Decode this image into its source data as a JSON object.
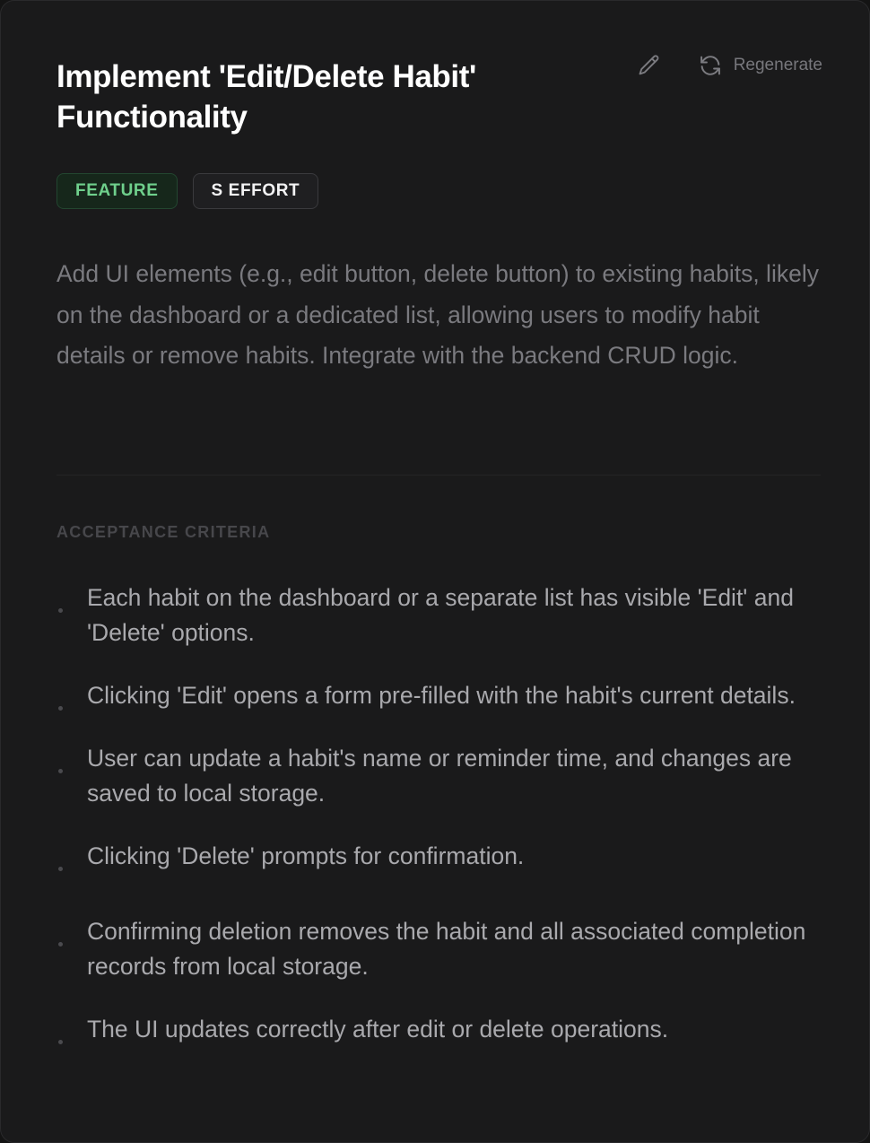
{
  "task": {
    "title": "Implement 'Edit/Delete Habit' Functionality",
    "edit_icon": "pencil-icon",
    "regenerate_icon": "refresh-icon",
    "regenerate_label": "Regenerate",
    "badges": {
      "type": "FEATURE",
      "effort": "S EFFORT"
    },
    "description": "Add UI elements (e.g., edit button, delete button) to existing habits, likely on the dashboard or a dedicated list, allowing users to modify habit details or remove habits. Integrate with the backend CRUD logic.",
    "acceptance_heading": "ACCEPTANCE CRITERIA",
    "acceptance_criteria": [
      "Each habit on the dashboard or a separate list has visible 'Edit' and 'Delete' options.",
      "Clicking 'Edit' opens a form pre-filled with the habit's current details.",
      "User can update a habit's name or reminder time, and changes are saved to local storage.",
      "Clicking 'Delete' prompts for confirmation.",
      "Confirming deletion removes the habit and all associated completion records from local storage.",
      "The UI updates correctly after edit or delete operations."
    ]
  },
  "colors": {
    "background": "#1a1a1b",
    "feature_badge_text": "#6fd08c",
    "feature_badge_bg": "#16271b",
    "muted_text": "#7a7a7f"
  }
}
